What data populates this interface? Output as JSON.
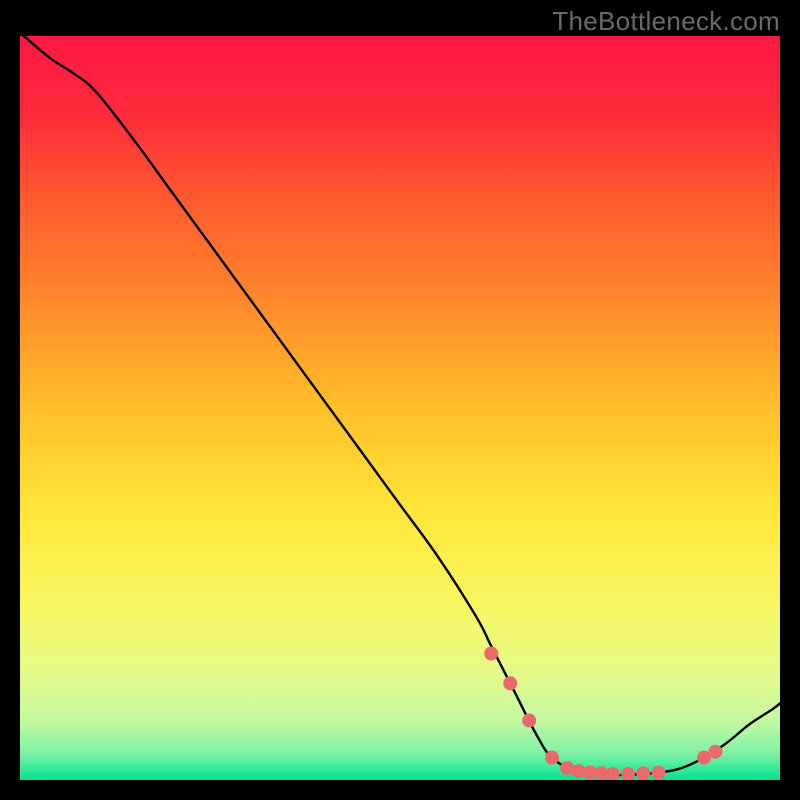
{
  "watermark": "TheBottleneck.com",
  "chart_data": {
    "type": "line",
    "title": "",
    "xlabel": "",
    "ylabel": "",
    "xlim": [
      0,
      100
    ],
    "ylim": [
      0,
      100
    ],
    "grid": false,
    "legend": false,
    "background_gradient_stops": [
      {
        "offset": 0.0,
        "color": "#ff1744"
      },
      {
        "offset": 0.1,
        "color": "#ff2a3c"
      },
      {
        "offset": 0.22,
        "color": "#ff5a2f"
      },
      {
        "offset": 0.36,
        "color": "#ff8a2b"
      },
      {
        "offset": 0.5,
        "color": "#ffbf2a"
      },
      {
        "offset": 0.64,
        "color": "#ffe63a"
      },
      {
        "offset": 0.76,
        "color": "#f8f760"
      },
      {
        "offset": 0.85,
        "color": "#e8fa86"
      },
      {
        "offset": 0.92,
        "color": "#c4f9a0"
      },
      {
        "offset": 0.965,
        "color": "#7ef2a6"
      },
      {
        "offset": 1.0,
        "color": "#00e38f"
      }
    ],
    "series": [
      {
        "name": "bottleneck-curve",
        "color": "#000000",
        "stroke_width": 2.4,
        "x": [
          0.5,
          4,
          7,
          10,
          15,
          20,
          25,
          30,
          35,
          40,
          45,
          50,
          55,
          60,
          62,
          65,
          68,
          70,
          73,
          76,
          80,
          84,
          87,
          90,
          93,
          96,
          99,
          100
        ],
        "y": [
          100,
          97,
          95,
          92.5,
          86,
          79,
          72,
          65,
          58,
          51,
          44,
          37,
          30,
          22,
          18,
          12,
          6,
          3,
          1.2,
          0.7,
          0.7,
          1.0,
          1.6,
          3,
          5,
          7.5,
          9.5,
          10.3
        ]
      }
    ],
    "markers": {
      "name": "highlight-dots",
      "color": "#e86a6a",
      "radius": 7,
      "x": [
        62,
        64.5,
        67,
        70,
        72,
        73.5,
        75,
        76.5,
        78,
        80,
        82,
        84,
        90,
        91.5
      ],
      "y": [
        17,
        13,
        8,
        3,
        1.6,
        1.2,
        1.0,
        0.9,
        0.8,
        0.8,
        0.9,
        1.0,
        3.0,
        3.8
      ]
    }
  }
}
